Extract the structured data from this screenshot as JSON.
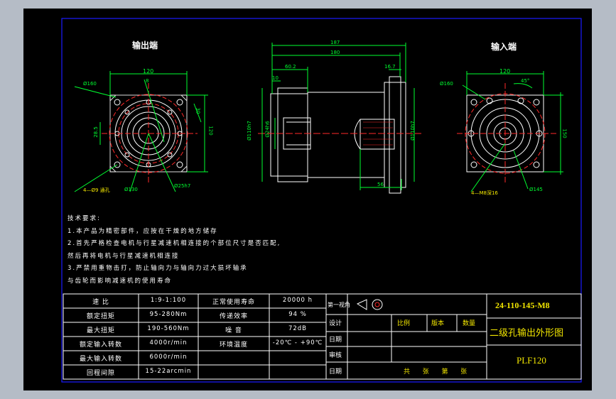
{
  "views": {
    "output_label": "输出端",
    "input_label": "输入端"
  },
  "dims": {
    "output": {
      "width": "120",
      "pcd": "Ø160",
      "square_side": "120",
      "side_small": "30",
      "key": "28.5",
      "holes": "4—Ø9 通孔",
      "spigot": "Ø130",
      "shaft": "Ø25h7",
      "top_small": "8"
    },
    "side": {
      "total": "187",
      "body": "180",
      "front": "60.2",
      "small1": "10",
      "small2": "16.7",
      "d1": "Ø110h7",
      "d2": "Ø24h6",
      "d3": "Ø110h7",
      "bottom": "56"
    },
    "input": {
      "width": "120",
      "pcd": "Ø160",
      "angle": "45°",
      "side": "150",
      "holes": "4—M8深16",
      "dia": "Ø145"
    }
  },
  "notes": [
    "技术要求:",
    "1.本产品为精密部件，应按在干燥的地方储存",
    "2.首先严格检查电机与行星减速机相连接的个部位尺寸是否匹配,",
    "然后再将电机与行星减速机相连接",
    "3.严禁用重物击打，防止轴向力与轴向力过大损坏轴承",
    "与齿轮而影响减速机的使用寿命"
  ],
  "specs": [
    [
      "速 比",
      "1:9-1:100",
      "正常使用寿命",
      "20000 h"
    ],
    [
      "额定扭矩",
      "95-280Nm",
      "传递效率",
      "94 %"
    ],
    [
      "最大扭矩",
      "190-560Nm",
      "噪 音",
      "72dB"
    ],
    [
      "额定输入转数",
      "4000r/min",
      "环境温度",
      "-20℃ - +90℃"
    ],
    [
      "最大输入转数",
      "6000r/min",
      "",
      ""
    ],
    [
      "回程间隙",
      "15-22arcmin",
      "",
      ""
    ]
  ],
  "title_block": {
    "projection": "第一视角",
    "rows": [
      "设计",
      "日期",
      "审核",
      "日期"
    ],
    "scale": "比例",
    "version": "版本",
    "quantity": "数量",
    "sheets": "共  张  第  张",
    "drawing_no": "24-110-145-M8",
    "drawing_title": "二级孔输出外形图",
    "model": "PLF120"
  },
  "colors": {
    "frame_bg": "#000000",
    "border": "#1a1aff",
    "dim": "#00ff30",
    "centerline": "#ff2a2a",
    "text_yellow": "#f2e600"
  }
}
